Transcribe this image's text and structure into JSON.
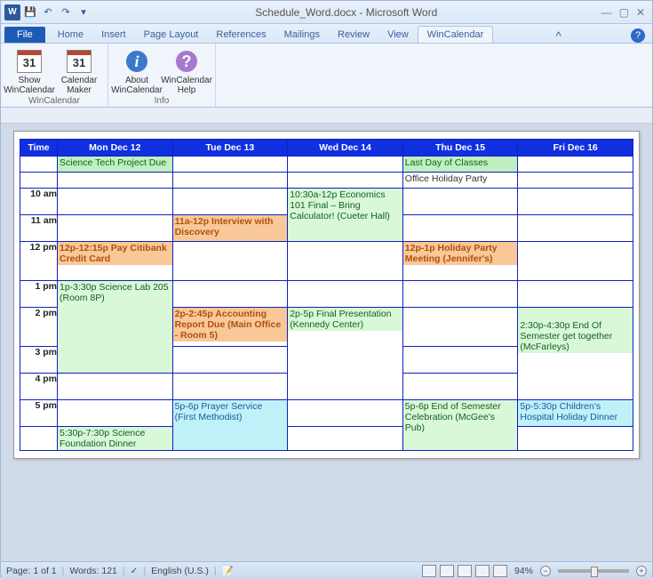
{
  "title": "Schedule_Word.docx - Microsoft Word",
  "qat": {
    "save": "💾",
    "undo": "↶",
    "redo": "↷"
  },
  "tabs": [
    "File",
    "Home",
    "Insert",
    "Page Layout",
    "References",
    "Mailings",
    "Review",
    "View",
    "WinCalendar"
  ],
  "active_tab": "WinCalendar",
  "ribbon": {
    "group1": {
      "label": "WinCalendar",
      "btn1": {
        "label": "Show WinCalendar",
        "num": "31"
      },
      "btn2": {
        "label": "Calendar Maker",
        "num": "31"
      }
    },
    "group2": {
      "label": "Info",
      "btn1": {
        "label": "About WinCalendar"
      },
      "btn2": {
        "label": "WinCalendar Help"
      }
    }
  },
  "cal": {
    "headers": [
      "Time",
      "Mon Dec 12",
      "Tue Dec 13",
      "Wed Dec 14",
      "Thu Dec 15",
      "Fri Dec 16"
    ],
    "times": [
      "",
      "",
      "10 am",
      "11 am",
      "12 pm",
      "1 pm",
      "2 pm",
      "3 pm",
      "4 pm",
      "5 pm",
      ""
    ],
    "allday1": {
      "mon": "Science Tech Project Due",
      "thu": "Last Day of Classes"
    },
    "allday2": {
      "thu": "Office Holiday Party"
    },
    "r10": {
      "wed": "10:30a-12p Economics 101 Final – Bring Calculator! (Cueter Hall)"
    },
    "r11": {
      "tue": "11a-12p Interview with Discovery"
    },
    "r12": {
      "mon": "12p-12:15p Pay Citibank Credit Card",
      "thu": "12p-1p Holiday Party Meeting (Jennifer's)"
    },
    "r13": {
      "mon": "1p-3:30p Science Lab 205 (Room 8P)"
    },
    "r14": {
      "tue": "2p-2:45p Accounting Report Due (Main Office - Room 5)",
      "wed": "2p-5p Final Presentation (Kennedy Center)",
      "fri": "2:30p-4:30p End Of Semester get together (McFarleys)"
    },
    "r17": {
      "tue": "5p-6p Prayer Service (First Methodist)",
      "thu": "5p-6p End of Semester Celebration (McGee's Pub)",
      "fri": "5p-5:30p Children's Hospital Holiday Dinner"
    },
    "r17b": {
      "mon": "5:30p-7:30p Science Foundation Dinner"
    }
  },
  "status": {
    "page": "Page: 1 of 1",
    "words": "Words: 121",
    "lang": "English (U.S.)",
    "zoom": "94%"
  }
}
